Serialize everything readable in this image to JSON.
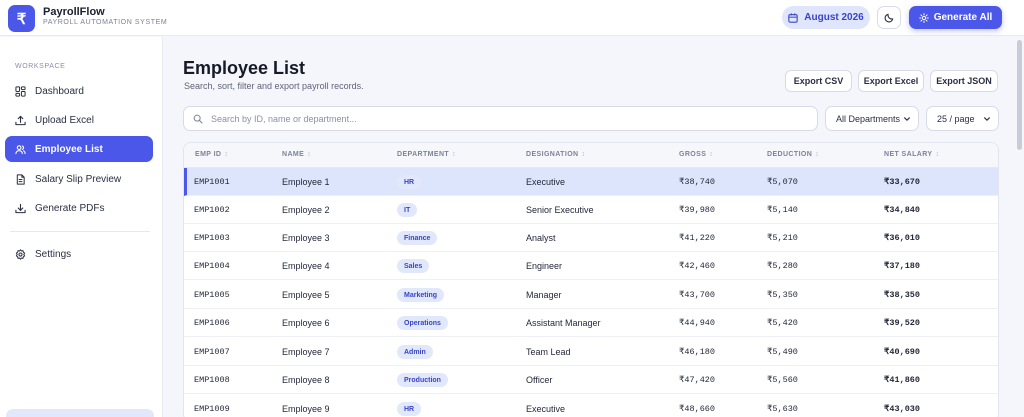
{
  "app": {
    "logo_glyph": "₹",
    "title": "PayrollFlow",
    "subtitle": "PAYROLL AUTOMATION SYSTEM",
    "accent": "#4a57e8"
  },
  "header": {
    "month_label": "August 2026",
    "theme_icon": "moon-icon",
    "generate_label": "Generate All"
  },
  "sidebar": {
    "section_label": "WORKSPACE",
    "items": [
      {
        "label": "Dashboard",
        "icon": "dashboard-icon",
        "active": false
      },
      {
        "label": "Upload Excel",
        "icon": "upload-icon",
        "active": false
      },
      {
        "label": "Employee List",
        "icon": "users-icon",
        "active": true
      },
      {
        "label": "Salary Slip Preview",
        "icon": "document-icon",
        "active": false
      },
      {
        "label": "Generate PDFs",
        "icon": "download-icon",
        "active": false
      },
      {
        "label": "Settings",
        "icon": "gear-icon",
        "active": false
      }
    ]
  },
  "main": {
    "title": "Employee List",
    "subtitle": "Search, sort, filter and export payroll records.",
    "export_csv": "Export CSV",
    "export_excel": "Export Excel",
    "export_json": "Export JSON",
    "search_placeholder": "Search by ID, name or department...",
    "department_filter": "All Departments",
    "page_size": "25 / page"
  },
  "table": {
    "columns": [
      "EMP ID",
      "NAME",
      "DEPARTMENT",
      "DESIGNATION",
      "GROSS",
      "DEDUCTION",
      "NET SALARY"
    ],
    "sort_glyph": "↕",
    "rows": [
      {
        "id": "EMP1001",
        "name": "Employee 1",
        "dept": "HR",
        "designation": "Executive",
        "gross": "₹38,740",
        "deduction": "₹5,070",
        "net": "₹33,670",
        "selected": true
      },
      {
        "id": "EMP1002",
        "name": "Employee 2",
        "dept": "IT",
        "designation": "Senior Executive",
        "gross": "₹39,980",
        "deduction": "₹5,140",
        "net": "₹34,840"
      },
      {
        "id": "EMP1003",
        "name": "Employee 3",
        "dept": "Finance",
        "designation": "Analyst",
        "gross": "₹41,220",
        "deduction": "₹5,210",
        "net": "₹36,010"
      },
      {
        "id": "EMP1004",
        "name": "Employee 4",
        "dept": "Sales",
        "designation": "Engineer",
        "gross": "₹42,460",
        "deduction": "₹5,280",
        "net": "₹37,180"
      },
      {
        "id": "EMP1005",
        "name": "Employee 5",
        "dept": "Marketing",
        "designation": "Manager",
        "gross": "₹43,700",
        "deduction": "₹5,350",
        "net": "₹38,350"
      },
      {
        "id": "EMP1006",
        "name": "Employee 6",
        "dept": "Operations",
        "designation": "Assistant Manager",
        "gross": "₹44,940",
        "deduction": "₹5,420",
        "net": "₹39,520"
      },
      {
        "id": "EMP1007",
        "name": "Employee 7",
        "dept": "Admin",
        "designation": "Team Lead",
        "gross": "₹46,180",
        "deduction": "₹5,490",
        "net": "₹40,690"
      },
      {
        "id": "EMP1008",
        "name": "Employee 8",
        "dept": "Production",
        "designation": "Officer",
        "gross": "₹47,420",
        "deduction": "₹5,560",
        "net": "₹41,860"
      },
      {
        "id": "EMP1009",
        "name": "Employee 9",
        "dept": "HR",
        "designation": "Executive",
        "gross": "₹48,660",
        "deduction": "₹5,630",
        "net": "₹43,030"
      }
    ]
  }
}
